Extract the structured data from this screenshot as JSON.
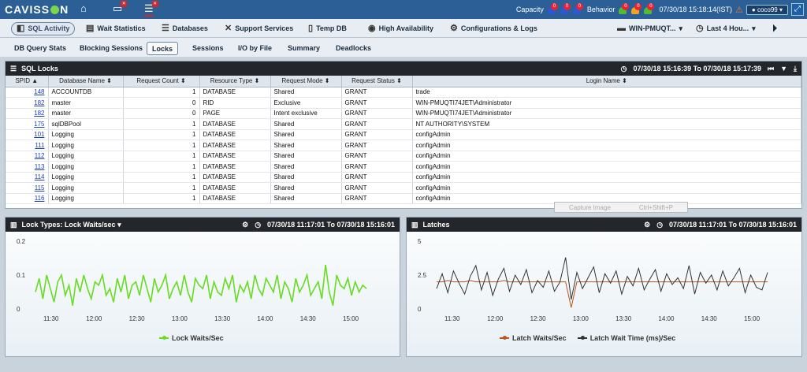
{
  "topbar": {
    "logo_pre": "CAVISS",
    "logo_post": "N",
    "capacity_label": "Capacity",
    "behavior_label": "Behavior",
    "timestamp": "07/30/18 15:18:14(IST)",
    "user": "coco99",
    "capacity_badges": [
      {
        "n": "0",
        "color": "#2b59d6"
      },
      {
        "n": "0",
        "color": "#2b59d6"
      },
      {
        "n": "0",
        "color": "#2b59d6"
      }
    ],
    "behavior_badges": [
      {
        "n": "0",
        "color": "#4dbd33"
      },
      {
        "n": "0",
        "color": "#f2a41d"
      },
      {
        "n": "0",
        "color": "#4dbd33"
      }
    ],
    "home_icon": "home-icon",
    "monitor_icon": "monitor-icon",
    "db_icon": "database-icon"
  },
  "menu": {
    "items": [
      "SQL Activity",
      "Wait Statistics",
      "Databases",
      "Support Services",
      "Temp DB",
      "High Availability",
      "Configurations & Logs"
    ],
    "server": "WIN-PMUQT...",
    "range": "Last 4 Hou..."
  },
  "subtabs": [
    "DB Query Stats",
    "Blocking Sessions",
    "Locks",
    "Sessions",
    "I/O by File",
    "Summary",
    "Deadlocks"
  ],
  "locks": {
    "title": "SQL Locks",
    "range": "07/30/18 15:16:39 To 07/30/18 15:17:39",
    "columns": [
      "SPID",
      "Database Name",
      "Request Count",
      "Resource Type",
      "Request Mode",
      "Request Status",
      "Login Name"
    ],
    "rows": [
      [
        "148",
        "ACCOUNTDB",
        "1",
        "DATABASE",
        "Shared",
        "GRANT",
        "trade"
      ],
      [
        "182",
        "master",
        "0",
        "RID",
        "Exclusive",
        "GRANT",
        "WIN-PMUQTI74JET\\Administrator"
      ],
      [
        "182",
        "master",
        "0",
        "PAGE",
        "Intent exclusive",
        "GRANT",
        "WIN-PMUQTI74JET\\Administrator"
      ],
      [
        "175",
        "sqlDBPool",
        "1",
        "DATABASE",
        "Shared",
        "GRANT",
        "NT AUTHORITY\\SYSTEM"
      ],
      [
        "101",
        "Logging",
        "1",
        "DATABASE",
        "Shared",
        "GRANT",
        "configAdmin"
      ],
      [
        "111",
        "Logging",
        "1",
        "DATABASE",
        "Shared",
        "GRANT",
        "configAdmin"
      ],
      [
        "112",
        "Logging",
        "1",
        "DATABASE",
        "Shared",
        "GRANT",
        "configAdmin"
      ],
      [
        "113",
        "Logging",
        "1",
        "DATABASE",
        "Shared",
        "GRANT",
        "configAdmin"
      ],
      [
        "114",
        "Logging",
        "1",
        "DATABASE",
        "Shared",
        "GRANT",
        "configAdmin"
      ],
      [
        "115",
        "Logging",
        "1",
        "DATABASE",
        "Shared",
        "GRANT",
        "configAdmin"
      ],
      [
        "116",
        "Logging",
        "1",
        "DATABASE",
        "Shared",
        "GRANT",
        "configAdmin"
      ]
    ]
  },
  "tooltip": {
    "label": "Capture Image",
    "shortcut": "Ctrl+Shift+P"
  },
  "chart_left": {
    "title": "Lock Types: Lock Waits/sec",
    "range": "07/30/18 11:17:01 To 07/30/18 15:16:01"
  },
  "chart_right": {
    "title": "Latches",
    "range": "07/30/18 11:17:01 To 07/30/18 15:16:01"
  },
  "chart_data": [
    {
      "type": "line",
      "x": [
        "11:30",
        "12:00",
        "12:30",
        "13:00",
        "13:30",
        "14:00",
        "14:30",
        "15:00"
      ],
      "ylim": [
        0,
        0.2
      ],
      "yticks": [
        "0.2",
        "0.1",
        "0"
      ],
      "series": [
        {
          "name": "Lock Waits/Sec",
          "color": "#66dd22",
          "values": [
            0.05,
            0.09,
            0.03,
            0.1,
            0.06,
            0.02,
            0.08,
            0.1,
            0.04,
            0.07,
            0.01,
            0.09,
            0.05,
            0.1,
            0.06,
            0.03,
            0.08,
            0.07,
            0.1,
            0.04,
            0.06,
            0.02,
            0.09,
            0.05,
            0.1,
            0.03,
            0.07,
            0.08,
            0.04,
            0.1,
            0.06,
            0.02,
            0.09,
            0.05,
            0.07,
            0.1,
            0.03,
            0.06,
            0.08,
            0.04,
            0.1,
            0.05,
            0.02,
            0.09,
            0.07,
            0.06,
            0.1,
            0.03,
            0.08,
            0.05,
            0.04,
            0.09,
            0.06,
            0.1,
            0.02,
            0.07,
            0.05,
            0.08,
            0.03,
            0.1,
            0.06,
            0.04,
            0.09,
            0.07,
            0.05,
            0.1,
            0.03,
            0.08,
            0.06,
            0.02,
            0.09,
            0.05,
            0.07,
            0.1,
            0.04,
            0.06,
            0.08,
            0.03,
            0.13,
            0.05,
            0.01,
            0.1,
            0.07,
            0.06,
            0.09,
            0.04,
            0.08,
            0.05,
            0.07,
            0.06
          ]
        }
      ]
    },
    {
      "type": "line",
      "x": [
        "11:30",
        "12:00",
        "12:30",
        "13:00",
        "13:30",
        "14:00",
        "14:30",
        "15:00"
      ],
      "ylim": [
        0,
        5
      ],
      "yticks": [
        "5",
        "2.5",
        "0"
      ],
      "series": [
        {
          "name": "Latch Waits/Sec",
          "color": "#b8561c",
          "values": [
            2.0,
            2.0,
            2.1,
            2.0,
            2.0,
            2.0,
            2.1,
            2.0,
            2.0,
            2.0,
            2.0,
            2.0,
            2.1,
            2.0,
            2.0,
            2.0,
            2.0,
            2.0,
            2.0,
            2.0,
            2.0,
            2.0,
            2.0,
            2.0,
            0.1,
            2.0,
            2.0,
            2.0,
            2.0,
            2.0,
            2.0,
            2.0,
            2.0,
            2.0,
            2.0,
            2.0,
            2.0,
            2.0,
            2.0,
            2.0,
            2.0,
            2.0,
            2.0,
            2.0,
            2.0,
            2.0,
            2.0,
            2.0,
            2.0,
            2.0,
            2.0,
            2.0,
            2.0,
            2.0,
            2.0,
            2.0,
            2.0,
            2.0,
            2.0,
            2.0
          ]
        },
        {
          "name": "Latch Wait Time (ms)/Sec",
          "color": "#333333",
          "values": [
            1.5,
            2.6,
            1.2,
            2.8,
            1.9,
            1.1,
            2.4,
            3.2,
            1.4,
            2.7,
            1.0,
            2.2,
            3.0,
            1.3,
            2.5,
            1.8,
            2.9,
            1.2,
            2.1,
            1.6,
            2.8,
            1.3,
            2.0,
            3.8,
            0.7,
            2.7,
            1.5,
            2.3,
            3.1,
            1.2,
            2.6,
            1.9,
            2.8,
            1.1,
            2.4,
            1.7,
            3.0,
            1.4,
            2.2,
            2.9,
            1.3,
            2.6,
            1.8,
            2.3,
            1.5,
            3.2,
            1.1,
            2.7,
            1.9,
            2.5,
            1.4,
            2.8,
            1.7,
            2.3,
            3.0,
            1.2,
            2.5,
            1.6,
            1.4,
            2.7
          ]
        }
      ]
    }
  ]
}
